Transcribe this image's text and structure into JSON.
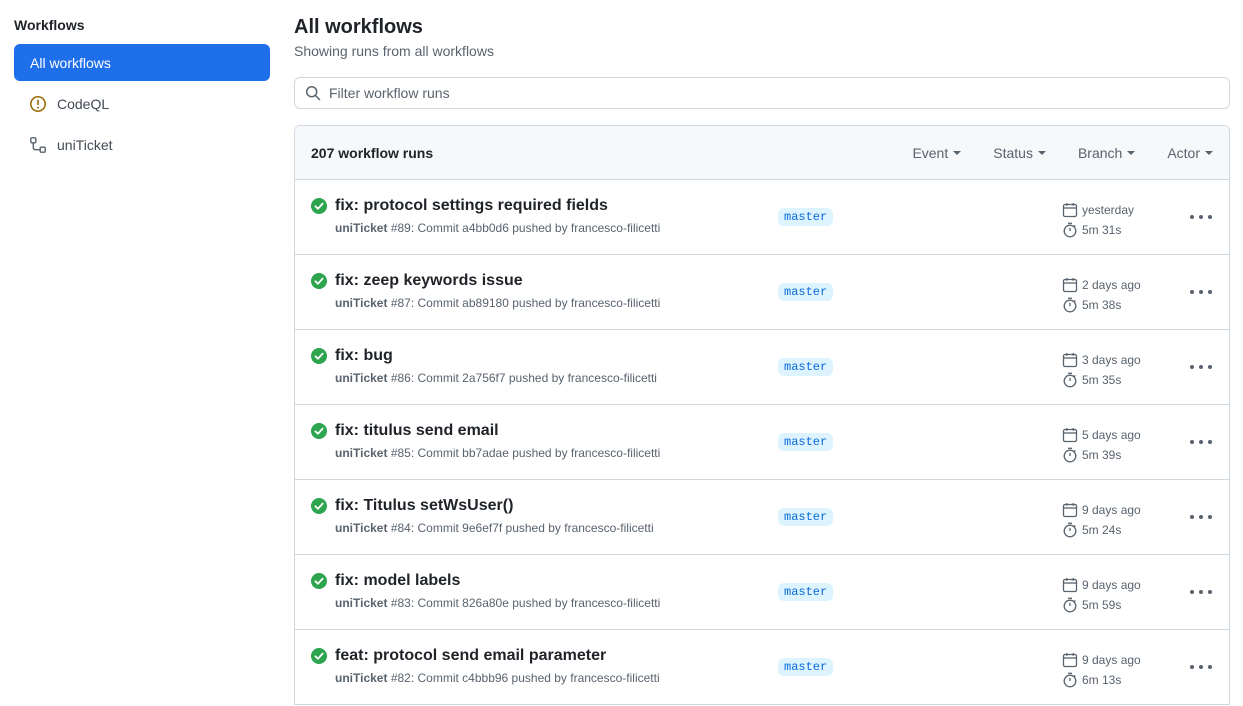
{
  "sidebar": {
    "heading": "Workflows",
    "items": [
      {
        "label": "All workflows",
        "icon": "none",
        "active": true
      },
      {
        "label": "CodeQL",
        "icon": "alert-circle-icon"
      },
      {
        "label": "uniTicket",
        "icon": "workflow-icon"
      }
    ]
  },
  "main": {
    "title": "All workflows",
    "subtitle": "Showing runs from all workflows",
    "filter": {
      "placeholder": "Filter workflow runs",
      "value": ""
    },
    "runs_header": {
      "count_label": "207 workflow runs",
      "filters": [
        "Event",
        "Status",
        "Branch",
        "Actor"
      ]
    },
    "runs": [
      {
        "title": "fix: protocol settings required fields",
        "workflow": "uniTicket",
        "detail": "#89: Commit a4bb0d6 pushed by francesco-filicetti",
        "branch": "master",
        "when": "yesterday",
        "duration": "5m 31s"
      },
      {
        "title": "fix: zeep keywords issue",
        "workflow": "uniTicket",
        "detail": "#87: Commit ab89180 pushed by francesco-filicetti",
        "branch": "master",
        "when": "2 days ago",
        "duration": "5m 38s"
      },
      {
        "title": "fix: bug",
        "workflow": "uniTicket",
        "detail": "#86: Commit 2a756f7 pushed by francesco-filicetti",
        "branch": "master",
        "when": "3 days ago",
        "duration": "5m 35s"
      },
      {
        "title": "fix: titulus send email",
        "workflow": "uniTicket",
        "detail": "#85: Commit bb7adae pushed by francesco-filicetti",
        "branch": "master",
        "when": "5 days ago",
        "duration": "5m 39s"
      },
      {
        "title": "fix: Titulus setWsUser()",
        "workflow": "uniTicket",
        "detail": "#84: Commit 9e6ef7f pushed by francesco-filicetti",
        "branch": "master",
        "when": "9 days ago",
        "duration": "5m 24s"
      },
      {
        "title": "fix: model labels",
        "workflow": "uniTicket",
        "detail": "#83: Commit 826a80e pushed by francesco-filicetti",
        "branch": "master",
        "when": "9 days ago",
        "duration": "5m 59s"
      },
      {
        "title": "feat: protocol send email parameter",
        "workflow": "uniTicket",
        "detail": "#82: Commit c4bbb96 pushed by francesco-filicetti",
        "branch": "master",
        "when": "9 days ago",
        "duration": "6m 13s"
      }
    ]
  },
  "colors": {
    "accent": "#1f6feb",
    "success": "#2da44e",
    "branch_bg": "#ddf4ff",
    "branch_fg": "#0969da",
    "codeql_icon": "#9a6700"
  }
}
